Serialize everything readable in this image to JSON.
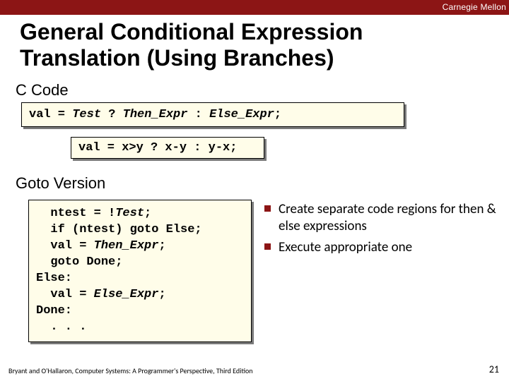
{
  "topbar": {
    "label": "Carnegie Mellon"
  },
  "title": {
    "line1": "General Conditional Expression",
    "line2": " Translation (Using Branches)"
  },
  "sections": {
    "ccode": "C Code",
    "goto": "Goto Version"
  },
  "code": {
    "box1": {
      "seg1": "val = ",
      "seg2": "Test",
      "seg3": " ? ",
      "seg4": "Then_Expr",
      "seg5": " : ",
      "seg6": "Else_Expr",
      "seg7": ";"
    },
    "box2": "val = x>y ? x-y : y-x;",
    "box3": {
      "l1a": "  ntest = !",
      "l1b": "Test",
      "l1c": ";",
      "l2": "  if (ntest) goto Else;",
      "l3a": "  val = ",
      "l3b": "Then_Expr",
      "l3c": ";",
      "l4": "  goto Done;",
      "l5": "Else:",
      "l6a": "  val = ",
      "l6b": "Else_Expr",
      "l6c": ";",
      "l7": "Done:",
      "l8": "  . . ."
    }
  },
  "bullets": {
    "b1": "Create separate code regions for then & else expressions",
    "b2": "Execute appropriate one"
  },
  "footer": {
    "left": "Bryant and O'Hallaron, Computer Systems: A Programmer's Perspective, Third Edition",
    "pageno": "21"
  }
}
